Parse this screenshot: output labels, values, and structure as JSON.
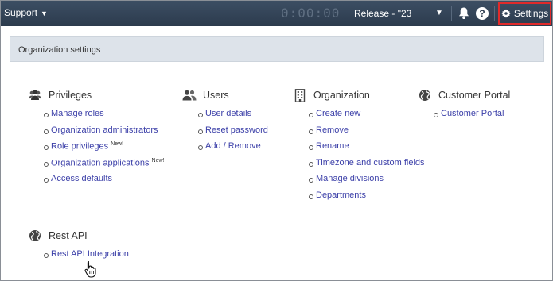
{
  "topbar": {
    "support_label": "Support",
    "timer": "0:00:00",
    "release_label": "Release - \"23",
    "settings_label": "Settings"
  },
  "header": {
    "title": "Organization settings"
  },
  "sections": {
    "privileges": {
      "title": "Privileges",
      "links": [
        "Manage roles",
        "Organization administrators",
        "Role privileges",
        "Organization applications",
        "Access defaults"
      ],
      "new_badge": "New!"
    },
    "users": {
      "title": "Users",
      "links": [
        "User details",
        "Reset password",
        "Add / Remove"
      ]
    },
    "organization": {
      "title": "Organization",
      "links": [
        "Create new",
        "Remove",
        "Rename",
        "Timezone and custom fields",
        "Manage divisions",
        "Departments"
      ]
    },
    "portal": {
      "title": "Customer Portal",
      "links": [
        "Customer Portal"
      ]
    },
    "restapi": {
      "title": "Rest API",
      "links": [
        "Rest API Integration"
      ]
    }
  },
  "colors": {
    "topbar": "#2f3e51",
    "link": "#3b3fa8",
    "highlight": "#e02a2a"
  }
}
